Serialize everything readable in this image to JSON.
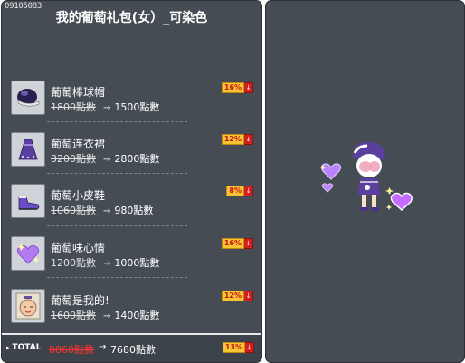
{
  "header": {
    "code": "09105083",
    "title": "我的葡萄礼包(女）_可染色"
  },
  "items": [
    {
      "name": "葡萄棒球帽",
      "old_price": "1800點數",
      "new_price": "1500點數",
      "discount": "16%"
    },
    {
      "name": "葡萄连衣裙",
      "old_price": "3200點數",
      "new_price": "2800點數",
      "discount": "12%"
    },
    {
      "name": "葡萄小皮鞋",
      "old_price": "1060點數",
      "new_price": "980點數",
      "discount": "8%"
    },
    {
      "name": "葡萄味心情",
      "old_price": "1200點數",
      "new_price": "1000點數",
      "discount": "16%"
    },
    {
      "name": "葡萄是我的!",
      "old_price": "1600點數",
      "new_price": "1400點數",
      "discount": "12%"
    }
  ],
  "total": {
    "label": "TOTAL",
    "old_price": "8860點數",
    "new_price": "7680點數",
    "discount": "13%"
  },
  "colors": {
    "panel": "#454c54",
    "badge_bg": "#f7c531",
    "badge_text": "#c4151c",
    "down_arrow": "#d21f1f",
    "strike_total": "#ff3333"
  },
  "icons": {
    "arrow": "→",
    "down": "↓"
  }
}
